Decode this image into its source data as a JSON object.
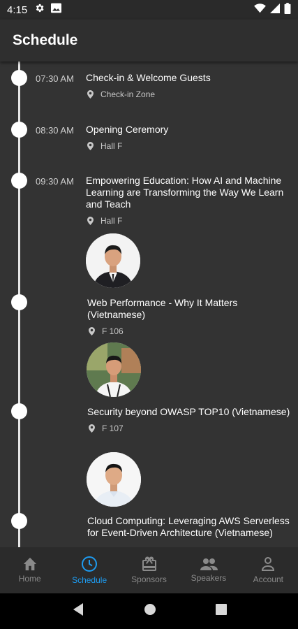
{
  "status_bar": {
    "time": "4:15"
  },
  "app_bar": {
    "title": "Schedule"
  },
  "schedule": {
    "timed": [
      {
        "time": "07:30 AM",
        "title": "Check-in & Welcome Guests",
        "location": "Check-in Zone"
      },
      {
        "time": "08:30 AM",
        "title": "Opening Ceremory",
        "location": "Hall F"
      },
      {
        "time": "09:30 AM",
        "title": "Empowering Education: How AI and Machine Learning are Transforming the Way We Learn and Teach",
        "location": "Hall F"
      }
    ],
    "talks": [
      {
        "title": "Web Performance - Why It Matters (Vietnamese)",
        "location": "F 106"
      },
      {
        "title": "Security beyond OWASP TOP10 (Vietnamese)",
        "location": "F 107"
      },
      {
        "title": "Cloud Computing: Leveraging AWS Serverless for Event-Driven Architecture (Vietnamese)"
      }
    ]
  },
  "bottom_nav": {
    "items": [
      {
        "label": "Home",
        "icon": "home-icon"
      },
      {
        "label": "Schedule",
        "icon": "clock-icon",
        "active": true
      },
      {
        "label": "Sponsors",
        "icon": "gift-icon"
      },
      {
        "label": "Speakers",
        "icon": "people-icon"
      },
      {
        "label": "Account",
        "icon": "person-icon"
      }
    ]
  },
  "colors": {
    "accent": "#1e9bf0",
    "background": "#333333",
    "app_bar": "#2f2f2f",
    "nav": "#2b2b2b"
  }
}
